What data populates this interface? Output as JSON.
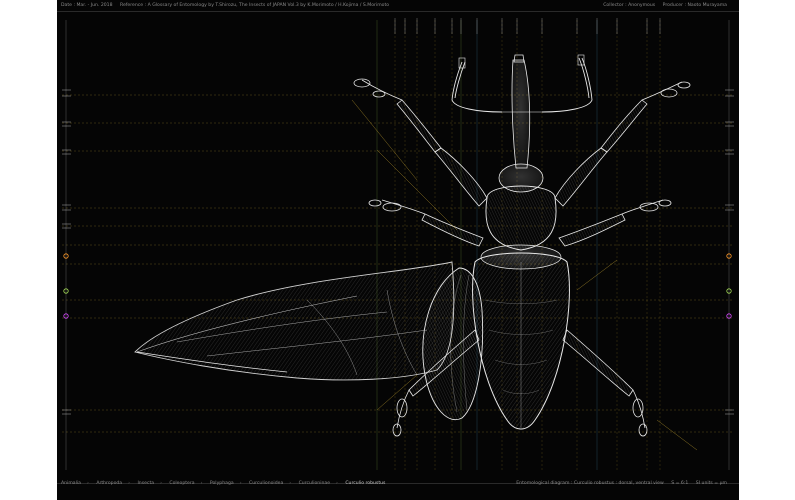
{
  "header": {
    "date": "Date : Mar. - Jun. 2018",
    "reference": "Reference : A Glossary of Entomology by T.Shirozu,  The Insects of JAPAN Vol.3 by K.Morimoto / H.Kojima / S.Morimoto",
    "collector": "Collector : Anonymous",
    "producer": "Producer : Naoto Murayama"
  },
  "footer": {
    "taxonomy": [
      "Animalia",
      "Arthropoda",
      "Insecta",
      "Coleoptera",
      "Polyphaga",
      "Curculionoidea",
      "Curculioninae"
    ],
    "species": "Curculio robustus",
    "diagram_title": "Entomological diagram : Curculio robustus : dorsal, ventral view",
    "scale": "S = 6:1",
    "units": "SI units = μm"
  },
  "colors": {
    "background": "#050505",
    "linework": "#e8e8e8",
    "guides": "#ffd23c"
  }
}
